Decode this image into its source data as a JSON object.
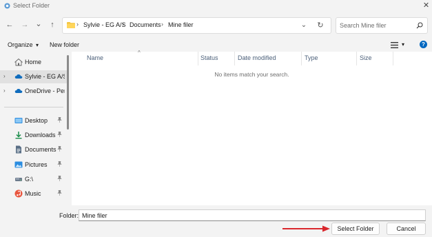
{
  "window": {
    "title": "Select Folder",
    "close_glyph": "✕"
  },
  "nav": {
    "back": "←",
    "forward": "→",
    "recent": "⌄",
    "up": "↑",
    "dropdown": "⌄",
    "refresh": "↻"
  },
  "breadcrumb": {
    "separator": "›",
    "items": [
      "Sylvie - EG A/S",
      "Documents",
      "Mine filer"
    ]
  },
  "search": {
    "placeholder": "Search Mine filer",
    "value": ""
  },
  "toolbar": {
    "organize_label": "Organize",
    "organize_caret": "▾",
    "new_folder_label": "New folder",
    "view_caret": "▾",
    "help_glyph": "?"
  },
  "sidebar": {
    "items": [
      {
        "label": "Home",
        "icon": "home-icon",
        "expander": "",
        "pin": ""
      },
      {
        "label": "Sylvie - EG A/S",
        "icon": "cloud-icon",
        "expander": "›",
        "pin": ""
      },
      {
        "label": "OneDrive - Personal",
        "icon": "cloud-icon",
        "expander": "›",
        "pin": ""
      },
      {
        "label": "Desktop",
        "icon": "desktop-icon",
        "expander": "",
        "pin": "📌"
      },
      {
        "label": "Downloads",
        "icon": "download-icon",
        "expander": "",
        "pin": "📌"
      },
      {
        "label": "Documents",
        "icon": "documents-icon",
        "expander": "",
        "pin": "📌"
      },
      {
        "label": "Pictures",
        "icon": "pictures-icon",
        "expander": "",
        "pin": "📌"
      },
      {
        "label": "G:\\",
        "icon": "drive-icon",
        "expander": "",
        "pin": "📌"
      },
      {
        "label": "Music",
        "icon": "music-icon",
        "expander": "",
        "pin": "📌"
      }
    ]
  },
  "content": {
    "columns": [
      "Name",
      "Status",
      "Date modified",
      "Type",
      "Size"
    ],
    "sort_glyph": "^",
    "empty_message": "No items match your search."
  },
  "footer": {
    "folder_label": "Folder:",
    "folder_value": "Mine filer",
    "select_button": "Select Folder",
    "cancel_button": "Cancel"
  },
  "colors": {
    "accent": "#0067c0",
    "annotation_arrow": "#d9262c"
  }
}
